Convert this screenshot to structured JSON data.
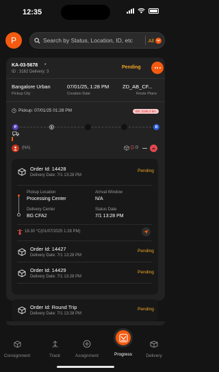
{
  "status_bar": {
    "time": "12:35"
  },
  "header": {
    "avatar_letter": "P",
    "search_placeholder": "Search by Status, Location, ID, etc",
    "filter_label": "All"
  },
  "consignment": {
    "id": "KA-03-5678",
    "id_meta": "ID : 3162  Delivery: 3",
    "status": "Pending",
    "pickup_city": {
      "value": "Bangalore Urban",
      "label": "Pickup City"
    },
    "creation_date": {
      "value": "07/01/25, 1:28 PM",
      "label": "Creation Date"
    },
    "route_plans": {
      "value": "ZD_AB_CF...",
      "label": "Route Plans"
    },
    "pickup_time": "Pickup: 07/01/25 01:28 PM",
    "eta": "ED: 2105.2 km",
    "driver": "(NA)",
    "box_count": "0",
    "box_total": "/3",
    "route_markers": [
      "P",
      "",
      "",
      "",
      "R"
    ]
  },
  "expanded_order": {
    "title": "Order Id: 14428",
    "subtitle": "Delivery Date: 7/1 13:28 PM",
    "status": "Pending",
    "pickup_location_label": "Pickup Location",
    "pickup_location": "Processing Center",
    "arrival_window_label": "Arrival Window",
    "arrival_window": "N/A",
    "delivery_center_label": "Delivery Center",
    "delivery_center": "BG CFA2",
    "status_date_label": "Status Date",
    "status_date": "7/1 13:28 PM",
    "temperature": "18.30 °C(01/07/2025 1:28 PM)"
  },
  "orders": [
    {
      "title": "Order Id: 14427",
      "subtitle": "Delivery Date: 7/1 13:28 PM",
      "status": "Pending"
    },
    {
      "title": "Order Id: 14429",
      "subtitle": "Delivery Date: 7/1 13:28 PM",
      "status": "Pending"
    },
    {
      "title": "Order Id: Round Trip",
      "subtitle": "Delivery Date: 7/1 13:28 PM",
      "status": "Pending"
    }
  ],
  "nav": {
    "items": [
      "Consignment",
      "Track",
      "Assignment",
      "Progress",
      "Delivery"
    ],
    "active": "Progress"
  },
  "colors": {
    "accent": "#f45a10",
    "pending": "#f5a623",
    "background": "#141414",
    "card": "#222222"
  }
}
